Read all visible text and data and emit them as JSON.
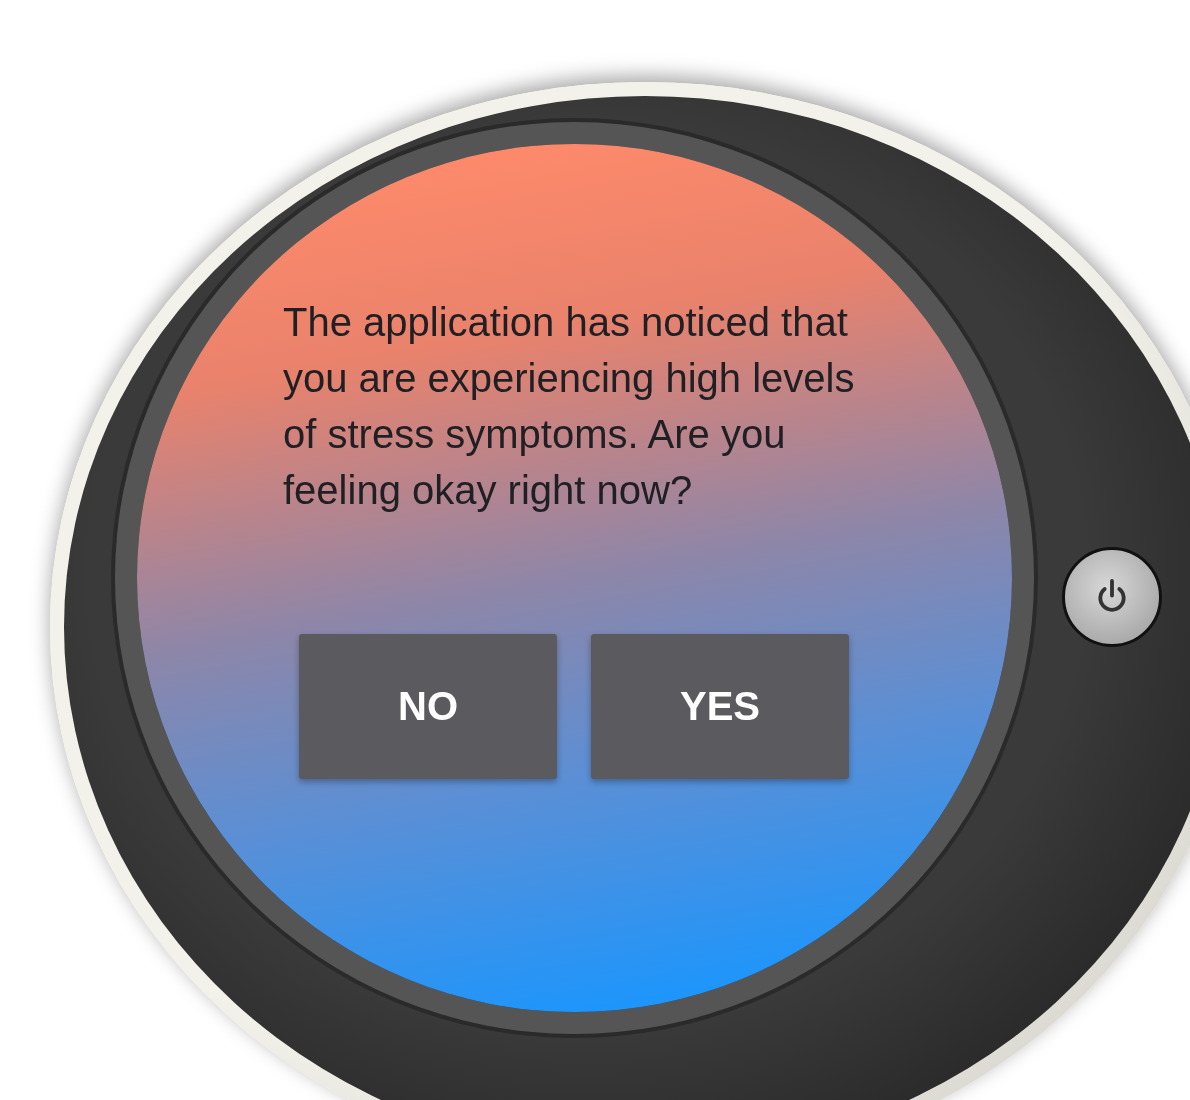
{
  "dialog": {
    "message": "The application has noticed that you are experiencing high levels of stress symptoms. Are you feeling okay right now?"
  },
  "buttons": [
    {
      "label": "NO"
    },
    {
      "label": "YES"
    }
  ]
}
